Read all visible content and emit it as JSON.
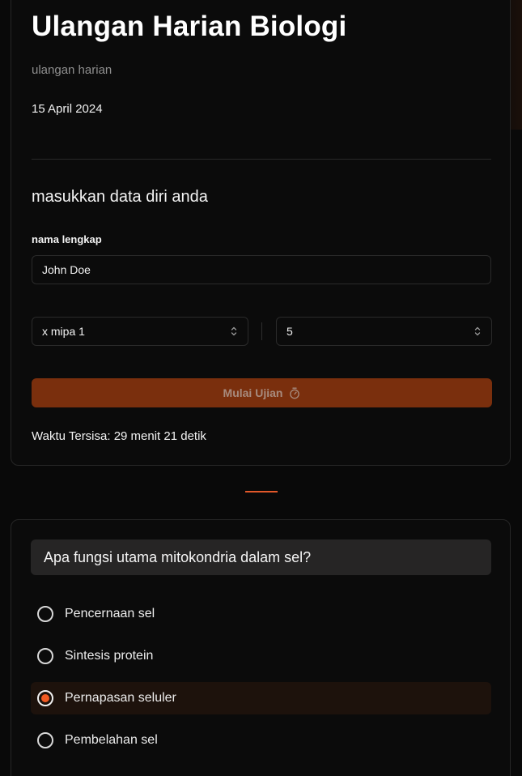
{
  "exam": {
    "title": "Ulangan Harian Biologi",
    "subtitle": "ulangan harian",
    "date": "15 April 2024"
  },
  "form": {
    "heading": "masukkan data diri anda",
    "name_label": "nama lengkap",
    "name_value": "John Doe",
    "class_select_value": "x mipa 1",
    "number_select_value": "5",
    "start_button_label": "Mulai Ujian",
    "time_remaining": "Waktu Tersisa: 29 menit 21 detik"
  },
  "question": {
    "text": "Apa fungsi utama mitokondria dalam sel?",
    "options": [
      {
        "label": "Pencernaan sel",
        "selected": false
      },
      {
        "label": "Sintesis protein",
        "selected": false
      },
      {
        "label": "Pernapasan seluler",
        "selected": true
      },
      {
        "label": "Pembelahan sel",
        "selected": false
      }
    ]
  },
  "colors": {
    "accent": "#f15a22",
    "button_bg": "#7a2f0d",
    "background": "#090909"
  },
  "icons": {
    "start_button": "stopwatch-icon",
    "select_indicator": "chevron-up-down-icon"
  }
}
